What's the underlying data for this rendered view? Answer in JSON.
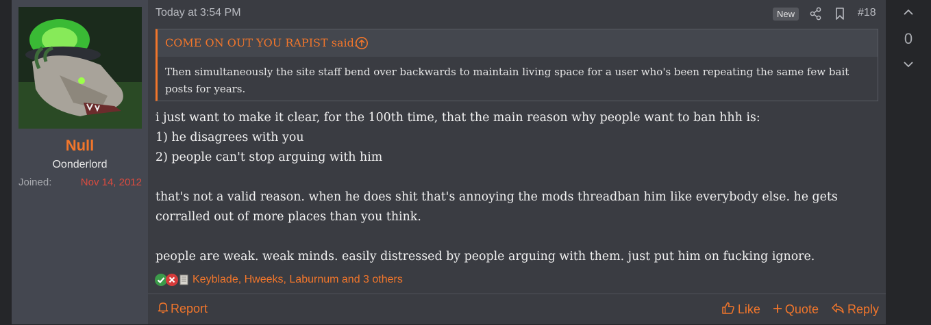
{
  "user": {
    "name": "Null",
    "title": "Oonderlord",
    "joined_label": "Joined:",
    "joined_value": "Nov 14, 2012"
  },
  "post": {
    "date": "Today at 3:54 PM",
    "badge": "New",
    "number": "#18",
    "quote": {
      "author": "COME ON OUT YOU RAPIST said:",
      "text": "Then simultaneously the site staff bend over backwards to maintain living space for a user who's been repeating the same few bait posts for years."
    },
    "lines": [
      "i just want to make it clear, for the 100th time, that the main reason why people want to ban hhh is:",
      "1) he disagrees with you",
      "2) people can't stop arguing with him",
      "",
      "that's not a valid reason. when he does shit that's annoying the mods threadban him like everybody else. he gets corralled out of more places than you think.",
      "",
      "people are weak. weak minds. easily distressed by people arguing with them. just put him on fucking ignore."
    ],
    "reactions_text": "Keyblade, Hweeks, Laburnum and 3 others"
  },
  "footer": {
    "report": "Report",
    "like": "Like",
    "quote": "Quote",
    "reply": "Reply"
  },
  "vote": {
    "count": "0"
  },
  "colors": {
    "accent": "#f2762b",
    "joined": "#dc4b3f",
    "background": "#3a3c42",
    "sidebar": "#444750"
  },
  "icons": [
    "share-icon",
    "bookmark-icon",
    "quote-jump-icon",
    "check-reaction-icon",
    "x-reaction-icon",
    "scroll-reaction-icon",
    "bell-icon",
    "thumbs-up-icon",
    "plus-icon",
    "reply-arrow-icon",
    "chevron-up-icon",
    "chevron-down-icon"
  ]
}
